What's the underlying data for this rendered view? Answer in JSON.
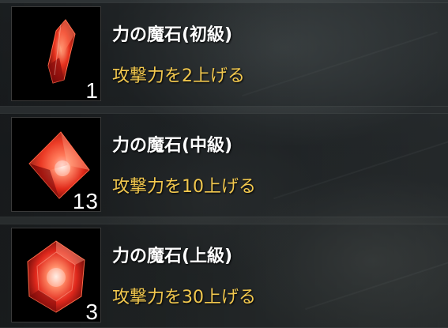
{
  "items": [
    {
      "name": "力の魔石(初級)",
      "description": "攻撃力を2上げる",
      "count": "1",
      "icon": "red-crystal-shard-icon"
    },
    {
      "name": "力の魔石(中級)",
      "description": "攻撃力を10上げる",
      "count": "13",
      "icon": "red-gem-medium-icon"
    },
    {
      "name": "力の魔石(上級)",
      "description": "攻撃力を30上げる",
      "count": "3",
      "icon": "red-gem-large-icon"
    }
  ],
  "colors": {
    "name_text": "#ffffff",
    "description_text": "#f2c84e",
    "gem_red": "#e0281c"
  }
}
